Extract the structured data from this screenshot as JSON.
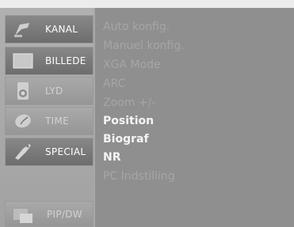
{
  "sidebar": {
    "items": [
      {
        "label": "KANAL",
        "icon": "satellite-dish-icon",
        "dim": false
      },
      {
        "label": "BILLEDE",
        "icon": "picture-icon",
        "dim": false
      },
      {
        "label": "LYD",
        "icon": "speaker-icon",
        "dim": true
      },
      {
        "label": "TIME",
        "icon": "clock-icon",
        "dim": true
      },
      {
        "label": "SPECIAL",
        "icon": "tag-icon",
        "dim": false
      },
      {
        "label": "PIP/DW",
        "icon": "pip-icon",
        "dim": true
      }
    ]
  },
  "menu": {
    "items": [
      {
        "label": "Auto konfig.",
        "enabled": false
      },
      {
        "label": "Manuel konfig.",
        "enabled": false
      },
      {
        "label": "XGA Mode",
        "enabled": false
      },
      {
        "label": "ARC",
        "enabled": false
      },
      {
        "label": "Zoom +/-",
        "enabled": false
      },
      {
        "label": "Position",
        "enabled": true
      },
      {
        "label": "Biograf",
        "enabled": true
      },
      {
        "label": "NR",
        "enabled": true
      },
      {
        "label": "PC Indstilling",
        "enabled": false
      }
    ]
  }
}
